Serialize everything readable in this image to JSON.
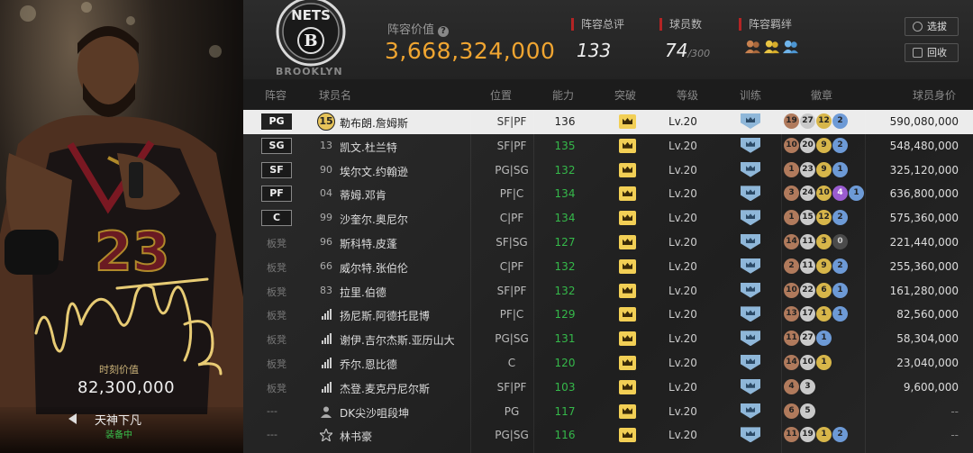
{
  "card": {
    "value_label": "时刻价值",
    "value": "82,300,000",
    "skin_name": "天神下凡",
    "skin_status": "装备中",
    "jersey_number": "23"
  },
  "header": {
    "team_logo_text": "NETS",
    "team_wordmark": "BROOKLYN",
    "lineup_value_label": "阵容价值",
    "lineup_value": "3,668,324,000",
    "rating_label": "阵容总评",
    "rating": "133",
    "count_label": "球员数",
    "count": "74",
    "count_max": "/300",
    "bond_label": "阵容羁绊",
    "select_button": "选拔",
    "recycle_button": "回收"
  },
  "columns": [
    "阵容",
    "球员名",
    "位置",
    "能力",
    "突破",
    "等级",
    "训练",
    "徽章",
    "球员身价"
  ],
  "rows": [
    {
      "slot": "PG",
      "num": "15",
      "num_style": "badge",
      "name": "勒布朗.詹姆斯",
      "pos": "SF|PF",
      "ability": "136",
      "level": "Lv.20",
      "badges": [
        [
          "b-bronze",
          "19"
        ],
        [
          "b-silver",
          "27"
        ],
        [
          "b-gold",
          "12"
        ],
        [
          "b-blue",
          "2"
        ]
      ],
      "salary": "590,080,000",
      "selected": true
    },
    {
      "slot": "SG",
      "num": "13",
      "name": "凯文.杜兰特",
      "pos": "SF|PF",
      "ability": "135",
      "level": "Lv.20",
      "badges": [
        [
          "b-bronze",
          "10"
        ],
        [
          "b-silver",
          "20"
        ],
        [
          "b-gold",
          "9"
        ],
        [
          "b-blue",
          "2"
        ]
      ],
      "salary": "548,480,000"
    },
    {
      "slot": "SF",
      "num": "90",
      "name": "埃尔文.约翰逊",
      "pos": "PG|SG",
      "ability": "132",
      "level": "Lv.20",
      "badges": [
        [
          "b-bronze",
          "1"
        ],
        [
          "b-silver",
          "23"
        ],
        [
          "b-gold",
          "9"
        ],
        [
          "b-blue",
          "1"
        ]
      ],
      "salary": "325,120,000"
    },
    {
      "slot": "PF",
      "num": "04",
      "name": "蒂姆.邓肯",
      "pos": "PF|C",
      "ability": "134",
      "level": "Lv.20",
      "badges": [
        [
          "b-bronze",
          "3"
        ],
        [
          "b-silver",
          "24"
        ],
        [
          "b-gold",
          "10"
        ],
        [
          "b-purple",
          "4"
        ],
        [
          "b-blue",
          "1"
        ]
      ],
      "salary": "636,800,000"
    },
    {
      "slot": "C",
      "num": "99",
      "name": "沙奎尔.奥尼尔",
      "pos": "C|PF",
      "ability": "134",
      "level": "Lv.20",
      "badges": [
        [
          "b-bronze",
          "1"
        ],
        [
          "b-silver",
          "15"
        ],
        [
          "b-gold",
          "12"
        ],
        [
          "b-blue",
          "2"
        ]
      ],
      "salary": "575,360,000"
    },
    {
      "slot": "板凳",
      "num": "96",
      "name": "斯科特.皮蓬",
      "pos": "SF|SG",
      "ability": "127",
      "level": "Lv.20",
      "badges": [
        [
          "b-bronze",
          "14"
        ],
        [
          "b-silver",
          "11"
        ],
        [
          "b-gold",
          "3"
        ],
        [
          "b-dark",
          "0"
        ]
      ],
      "salary": "221,440,000"
    },
    {
      "slot": "板凳",
      "num": "66",
      "name": "威尔特.张伯伦",
      "pos": "C|PF",
      "ability": "132",
      "level": "Lv.20",
      "badges": [
        [
          "b-bronze",
          "2"
        ],
        [
          "b-silver",
          "11"
        ],
        [
          "b-gold",
          "9"
        ],
        [
          "b-blue",
          "2"
        ]
      ],
      "salary": "255,360,000"
    },
    {
      "slot": "板凳",
      "num": "83",
      "name": "拉里.伯德",
      "pos": "SF|PF",
      "ability": "132",
      "level": "Lv.20",
      "badges": [
        [
          "b-bronze",
          "10"
        ],
        [
          "b-silver",
          "22"
        ],
        [
          "b-gold",
          "6"
        ],
        [
          "b-blue",
          "1"
        ]
      ],
      "salary": "161,280,000"
    },
    {
      "slot": "板凳",
      "num": "",
      "num_style": "bar",
      "name": "扬尼斯.阿德托昆博",
      "pos": "PF|C",
      "ability": "129",
      "level": "Lv.20",
      "badges": [
        [
          "b-bronze",
          "13"
        ],
        [
          "b-silver",
          "17"
        ],
        [
          "b-gold",
          "1"
        ],
        [
          "b-blue",
          "1"
        ]
      ],
      "salary": "82,560,000"
    },
    {
      "slot": "板凳",
      "num": "",
      "num_style": "bar",
      "name": "谢伊.吉尔杰斯.亚历山大",
      "pos": "PG|SG",
      "ability": "131",
      "level": "Lv.20",
      "badges": [
        [
          "b-bronze",
          "11"
        ],
        [
          "b-silver",
          "27"
        ],
        [
          "b-blue",
          "1"
        ]
      ],
      "salary": "58,304,000"
    },
    {
      "slot": "板凳",
      "num": "",
      "num_style": "bar",
      "name": "乔尔.恩比德",
      "pos": "C",
      "ability": "120",
      "level": "Lv.20",
      "badges": [
        [
          "b-bronze",
          "14"
        ],
        [
          "b-silver",
          "10"
        ],
        [
          "b-gold",
          "1"
        ]
      ],
      "salary": "23,040,000"
    },
    {
      "slot": "板凳",
      "num": "",
      "num_style": "bar",
      "name": "杰登.麦克丹尼尔斯",
      "pos": "SF|PF",
      "ability": "103",
      "level": "Lv.20",
      "badges": [
        [
          "b-bronze",
          "4"
        ],
        [
          "b-silver",
          "3"
        ]
      ],
      "salary": "9,600,000"
    },
    {
      "slot": "---",
      "num": "",
      "num_style": "person",
      "name": "DK尖沙咀段坤",
      "pos": "PG",
      "ability": "117",
      "level": "Lv.20",
      "badges": [
        [
          "b-bronze",
          "6"
        ],
        [
          "b-silver",
          "5"
        ]
      ],
      "salary": "--"
    },
    {
      "slot": "---",
      "num": "",
      "num_style": "star",
      "name": "林书豪",
      "pos": "PG|SG",
      "ability": "116",
      "level": "Lv.20",
      "badges": [
        [
          "b-bronze",
          "11"
        ],
        [
          "b-silver",
          "19"
        ],
        [
          "b-gold",
          "1"
        ],
        [
          "b-blue",
          "2"
        ]
      ],
      "salary": "--"
    }
  ]
}
